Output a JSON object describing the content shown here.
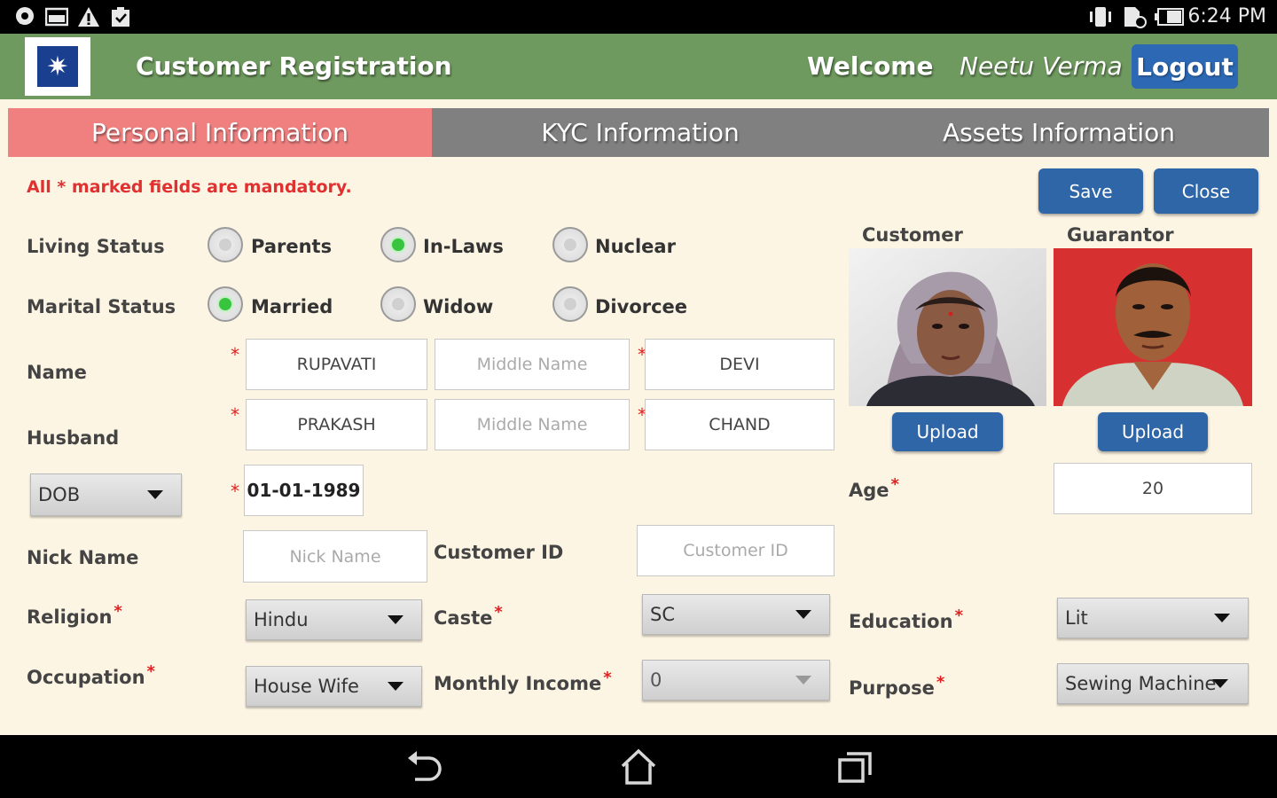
{
  "status_bar": {
    "time": "6:24 PM",
    "left_icons": [
      "chat-icon",
      "image-icon",
      "warning-icon",
      "clipboard-icon"
    ],
    "right_icons": [
      "vibrate-icon",
      "sim-icon",
      "battery-icon"
    ]
  },
  "app_bar": {
    "title": "Customer Registration",
    "welcome": "Welcome",
    "user_name": "Neetu  Verma",
    "logout_label": "Logout"
  },
  "tabs": [
    {
      "label": "Personal Information",
      "active": true
    },
    {
      "label": "KYC Information",
      "active": false
    },
    {
      "label": "Assets Information",
      "active": false
    }
  ],
  "form": {
    "mandatory_note": "All  *  marked fields are mandatory.",
    "save_label": "Save",
    "close_label": "Close",
    "living_status": {
      "label": "Living Status",
      "options": [
        {
          "label": "Parents",
          "checked": false
        },
        {
          "label": "In-Laws",
          "checked": true
        },
        {
          "label": "Nuclear",
          "checked": false
        }
      ]
    },
    "marital_status": {
      "label": "Marital Status",
      "options": [
        {
          "label": "Married",
          "checked": true
        },
        {
          "label": "Widow",
          "checked": false
        },
        {
          "label": "Divorcee",
          "checked": false
        }
      ]
    },
    "name": {
      "label": "Name",
      "first": "RUPAVATI",
      "middle_placeholder": "Middle Name",
      "last": "DEVI"
    },
    "husband": {
      "label": "Husband",
      "first": "PRAKASH",
      "middle_placeholder": "Middle Name",
      "last": "CHAND"
    },
    "dob": {
      "selector": "DOB",
      "value": "01-01-1989"
    },
    "age": {
      "label": "Age",
      "value": "20"
    },
    "nick_name": {
      "label": "Nick Name",
      "placeholder": "Nick Name"
    },
    "customer_id": {
      "label": "Customer ID",
      "placeholder": "Customer ID"
    },
    "religion": {
      "label": "Religion",
      "value": "Hindu"
    },
    "caste": {
      "label": "Caste",
      "value": "SC"
    },
    "education": {
      "label": "Education",
      "value": "Lit"
    },
    "occupation": {
      "label": "Occupation",
      "value": "House Wife"
    },
    "monthly_income": {
      "label": "Monthly Income",
      "value": "0"
    },
    "purpose": {
      "label": "Purpose",
      "value": "Sewing Machine"
    }
  },
  "photos": {
    "customer_label": "Customer",
    "guarantor_label": "Guarantor",
    "upload_label": "Upload"
  },
  "colors": {
    "app_bar": "#6f9a5f",
    "active_tab": "#f08080",
    "tab_bar": "#808080",
    "button": "#2f66a8",
    "required": "#e02020",
    "background": "#fdf5e4"
  }
}
